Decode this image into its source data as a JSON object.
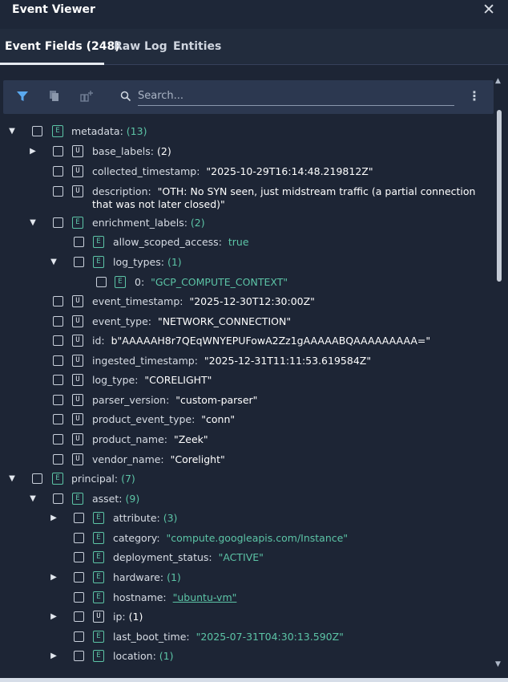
{
  "window": {
    "title": "Event Viewer",
    "close_glyph": "✕"
  },
  "tabs": [
    {
      "label": "Event Fields (248)"
    },
    {
      "label": "Raw Log"
    },
    {
      "label": "Entities"
    }
  ],
  "toolbar": {
    "search_placeholder": "Search...",
    "more_glyph": "⋮"
  },
  "tree": {
    "metadata": {
      "key": "metadata:",
      "count": "(13)"
    },
    "base_labels": {
      "key": "base_labels:",
      "count": "(2)"
    },
    "collected_timestamp": {
      "key": "collected_timestamp:",
      "value": "\"2025-10-29T16:14:48.219812Z\""
    },
    "description": {
      "key": "description:",
      "value": "\"OTH: No SYN seen, just midstream traffic (a partial connection that was not later closed)\""
    },
    "enrichment_labels": {
      "key": "enrichment_labels:",
      "count": "(2)"
    },
    "allow_scoped_access": {
      "key": "allow_scoped_access:",
      "value": "true"
    },
    "log_types": {
      "key": "log_types:",
      "count": "(1)"
    },
    "log_types_0": {
      "key": "0:",
      "value": "\"GCP_COMPUTE_CONTEXT\""
    },
    "event_timestamp": {
      "key": "event_timestamp:",
      "value": "\"2025-12-30T12:30:00Z\""
    },
    "event_type": {
      "key": "event_type:",
      "value": "\"NETWORK_CONNECTION\""
    },
    "id": {
      "key": "id:",
      "value": "b\"AAAAAH8r7QEqWNYEPUFowA2Zz1gAAAAABQAAAAAAAAA=\""
    },
    "ingested_timestamp": {
      "key": "ingested_timestamp:",
      "value": "\"2025-12-31T11:11:53.619584Z\""
    },
    "log_type": {
      "key": "log_type:",
      "value": "\"CORELIGHT\""
    },
    "parser_version": {
      "key": "parser_version:",
      "value": "\"custom-parser\""
    },
    "product_event_type": {
      "key": "product_event_type:",
      "value": "\"conn\""
    },
    "product_name": {
      "key": "product_name:",
      "value": "\"Zeek\""
    },
    "vendor_name": {
      "key": "vendor_name:",
      "value": "\"Corelight\""
    },
    "principal": {
      "key": "principal:",
      "count": "(7)"
    },
    "asset": {
      "key": "asset:",
      "count": "(9)"
    },
    "attribute": {
      "key": "attribute:",
      "count": "(3)"
    },
    "category": {
      "key": "category:",
      "value": "\"compute.googleapis.com/Instance\""
    },
    "deployment_status": {
      "key": "deployment_status:",
      "value": "\"ACTIVE\""
    },
    "hardware": {
      "key": "hardware:",
      "count": "(1)"
    },
    "hostname": {
      "key": "hostname:",
      "value": "\"ubuntu-vm\""
    },
    "ip": {
      "key": "ip:",
      "count": "(1)"
    },
    "last_boot_time": {
      "key": "last_boot_time:",
      "value": "\"2025-07-31T04:30:13.590Z\""
    },
    "location": {
      "key": "location:",
      "count": "(1)"
    }
  },
  "glyphs": {
    "tag_u": "U",
    "tag_e": "E",
    "caret_open": "▼",
    "caret_closed": "▶"
  },
  "icons": [
    "filter-icon",
    "copy-icon",
    "add-column-icon",
    "search-icon",
    "more-vertical-icon",
    "close-icon"
  ],
  "colors": {
    "background": "#1d2535",
    "toolbar": "#2c3850",
    "accent_green": "#5cc4a6",
    "filter_blue": "#5aa9f0"
  }
}
